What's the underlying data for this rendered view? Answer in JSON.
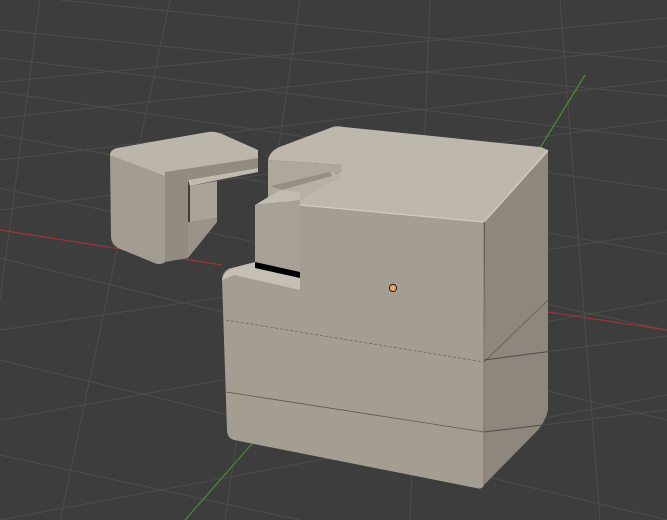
{
  "viewport": {
    "background": "#3d3d3d",
    "grid_color": "#4d4d4d",
    "x_axis_color": "#9b3636",
    "y_axis_color": "#4e8a35"
  },
  "scene": {
    "objects": [
      {
        "name": "main-block",
        "material_color": "#a59e92"
      },
      {
        "name": "detached-piece",
        "material_color": "#a59e92"
      }
    ],
    "origin_marker_color": "#f2a06a"
  }
}
